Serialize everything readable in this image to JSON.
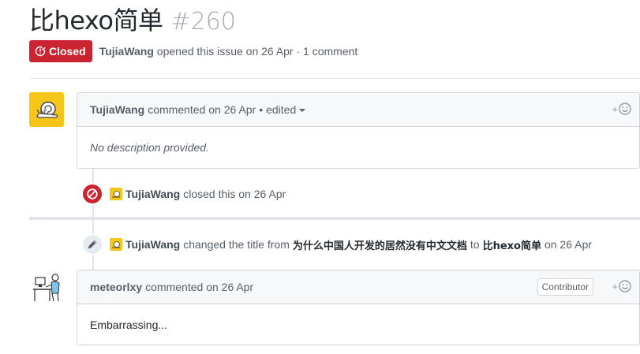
{
  "issue": {
    "title": "比hexo简单",
    "number": "#260",
    "state": "Closed",
    "author": "TujiaWang",
    "meta_suffix": "opened this issue on 26 Apr · 1 comment"
  },
  "comment1": {
    "author": "TujiaWang",
    "action": "commented on 26 Apr",
    "separator": "•",
    "edited": "edited",
    "body": "No description provided."
  },
  "event_closed": {
    "actor": "TujiaWang",
    "text": "closed this on 26 Apr"
  },
  "event_renamed": {
    "actor": "TujiaWang",
    "text1": "changed the title from",
    "old_title": "为什么中国人开发的居然没有中文文档",
    "text2": "to",
    "new_title": "比hexo简单",
    "text3": "on 26 Apr"
  },
  "comment2": {
    "author": "meteorlxy",
    "action": "commented on 26 Apr",
    "badge": "Contributor",
    "body": "Embarrassing..."
  },
  "reaction_plus": "+",
  "colors": {
    "closed_red": "#cb2431",
    "avatar_yellow": "#f5c518",
    "header_bg": "#f6f8fa",
    "border": "#d1d5da"
  }
}
